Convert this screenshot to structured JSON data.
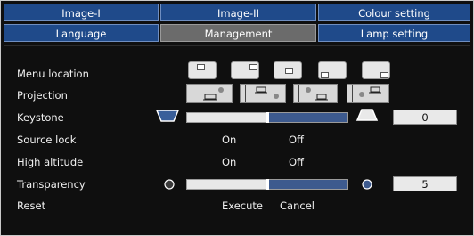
{
  "tabs_row1": [
    {
      "label": "Image-I",
      "active": false
    },
    {
      "label": "Image-II",
      "active": false
    },
    {
      "label": "Colour setting",
      "active": false
    }
  ],
  "tabs_row2": [
    {
      "label": "Language",
      "active": false
    },
    {
      "label": "Management",
      "active": true
    },
    {
      "label": "Lamp setting",
      "active": false
    }
  ],
  "settings": {
    "menu_location": {
      "label": "Menu location"
    },
    "projection": {
      "label": "Projection"
    },
    "keystone": {
      "label": "Keystone",
      "value": "0",
      "level": 0.5
    },
    "source_lock": {
      "label": "Source lock",
      "on": "On",
      "off": "Off"
    },
    "high_altitude": {
      "label": "High altitude",
      "on": "On",
      "off": "Off"
    },
    "transparency": {
      "label": "Transparency",
      "value": "5",
      "level": 0.5
    },
    "reset": {
      "label": "Reset",
      "execute": "Execute",
      "cancel": "Cancel"
    }
  },
  "colors": {
    "tab_blue": "#1f4a8a",
    "tab_active": "#6b6b6b",
    "slider_fill": "#3d5a8e",
    "background": "#0f0f0f"
  }
}
